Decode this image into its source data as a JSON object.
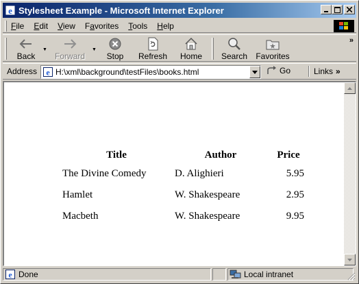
{
  "window": {
    "title": "Stylesheet Example - Microsoft Internet Explorer"
  },
  "menu": {
    "items": [
      {
        "label": "File",
        "accel": "F",
        "rest": "ile"
      },
      {
        "label": "Edit",
        "accel": "E",
        "rest": "dit"
      },
      {
        "label": "View",
        "accel": "V",
        "rest": "iew"
      },
      {
        "label": "Favorites",
        "pre": "F",
        "accel": "a",
        "rest": "vorites"
      },
      {
        "label": "Tools",
        "accel": "T",
        "rest": "ools"
      },
      {
        "label": "Help",
        "accel": "H",
        "rest": "elp"
      }
    ]
  },
  "toolbar": {
    "back": "Back",
    "forward": "Forward",
    "stop": "Stop",
    "refresh": "Refresh",
    "home": "Home",
    "search": "Search",
    "favorites": "Favorites",
    "overflow": "»"
  },
  "address": {
    "label": "Address",
    "url": "H:\\xml\\background\\testFiles\\books.html",
    "go": "Go",
    "links": "Links",
    "links_overflow": "»"
  },
  "table": {
    "headers": [
      "Title",
      "Author",
      "Price"
    ],
    "rows": [
      {
        "title": "The Divine Comedy",
        "author": "D. Alighieri",
        "price": "5.95"
      },
      {
        "title": "Hamlet",
        "author": "W. Shakespeare",
        "price": "2.95"
      },
      {
        "title": "Macbeth",
        "author": "W. Shakespeare",
        "price": "9.95"
      }
    ]
  },
  "status": {
    "text": "Done",
    "zone": "Local intranet"
  },
  "icons": {
    "window": "ie-logo-icon",
    "back": "back-arrow-icon",
    "forward": "forward-arrow-icon",
    "stop": "stop-icon",
    "refresh": "refresh-icon",
    "home": "home-icon",
    "search": "search-icon",
    "favorites": "favorites-icon"
  },
  "colors": {
    "title_start": "#0a246a",
    "title_end": "#a6caf0",
    "chrome": "#d4d0c8"
  }
}
